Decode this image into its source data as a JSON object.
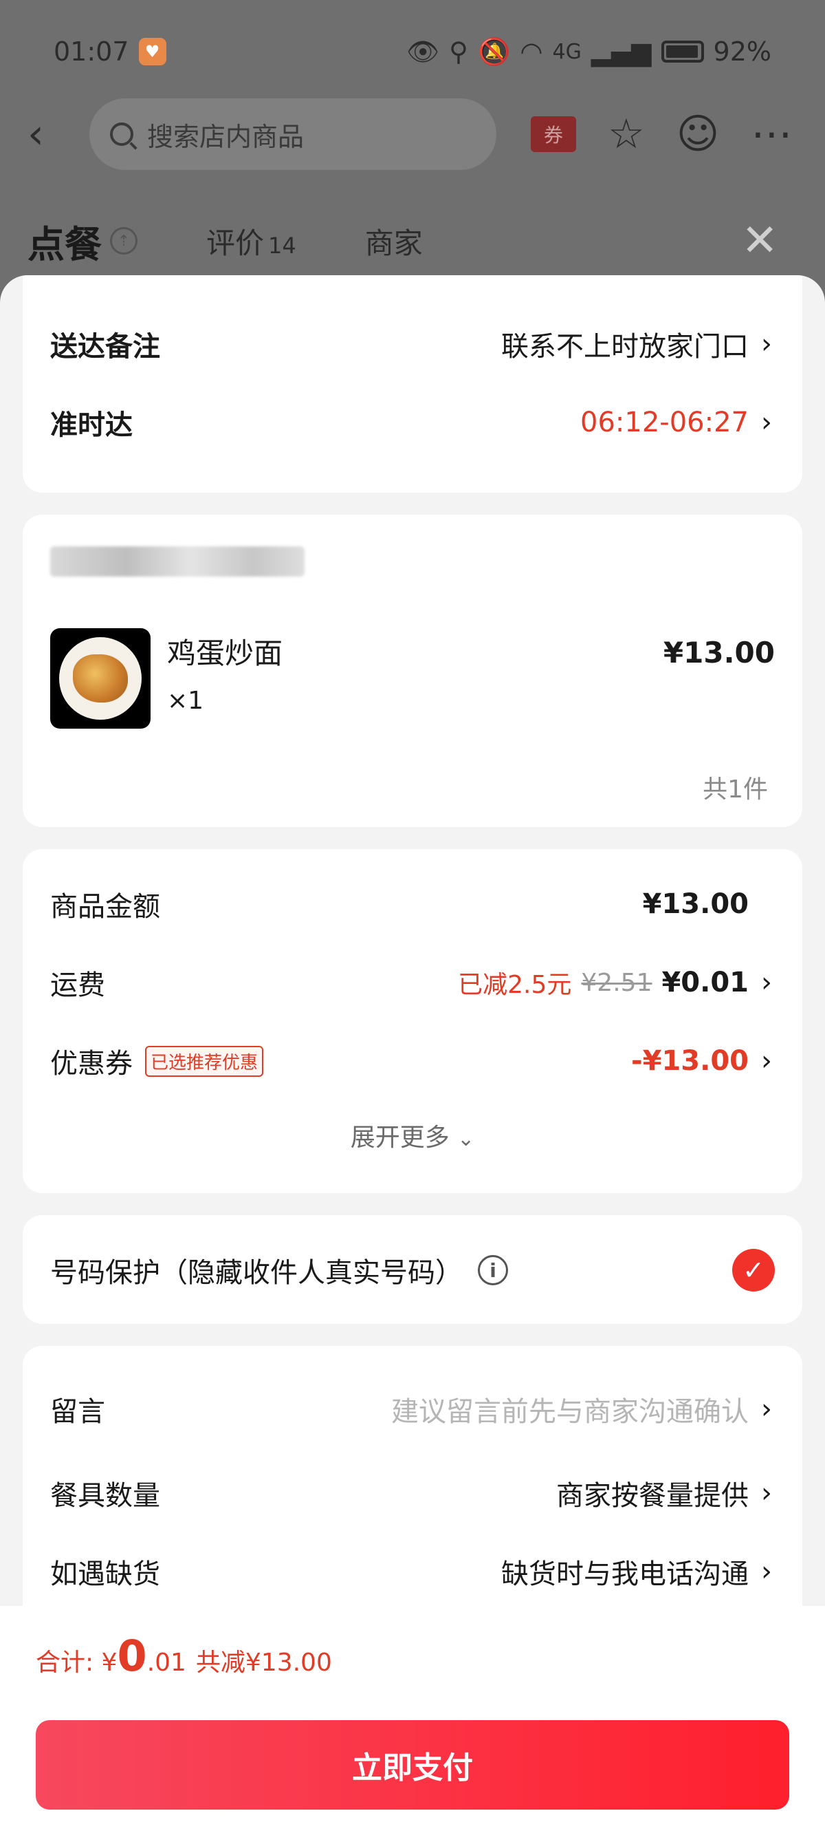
{
  "status_bar": {
    "time": "01:07",
    "signal": "4G",
    "battery": "92%"
  },
  "nav": {
    "search_placeholder": "搜索店内商品",
    "coupon_label": "券"
  },
  "tabs": {
    "order": "点餐",
    "reviews": "评价",
    "reviews_count": "14",
    "merchant": "商家"
  },
  "delivery": {
    "note_label": "送达备注",
    "note_value": "联系不上时放家门口",
    "ontime_label": "准时达",
    "ontime_value": "06:12-06:27"
  },
  "order": {
    "item_name": "鸡蛋炒面",
    "item_qty": "×1",
    "item_price": "¥13.00",
    "total_count": "共1件"
  },
  "pricing": {
    "goods_label": "商品金额",
    "goods_value": "¥13.00",
    "shipping_label": "运费",
    "shipping_discount": "已减2.5元",
    "shipping_original": "¥2.51",
    "shipping_value": "¥0.01",
    "coupon_label": "优惠券",
    "coupon_tag": "已选推荐优惠",
    "coupon_value": "-¥13.00",
    "expand_label": "展开更多"
  },
  "privacy": {
    "label": "号码保护（隐藏收件人真实号码）",
    "checked": true
  },
  "extras": {
    "message_label": "留言",
    "message_placeholder": "建议留言前先与商家沟通确认",
    "tableware_label": "餐具数量",
    "tableware_value": "商家按餐量提供",
    "stockout_label": "如遇缺货",
    "stockout_value": "缺货时与我电话沟通"
  },
  "footer": {
    "total_prefix": "合计: ¥",
    "total_int": "0",
    "total_dec": ".01",
    "saved": "共减¥13.00",
    "pay_button": "立即支付"
  },
  "colors": {
    "accent_red": "#e23b26",
    "pay_button": "#ff1f2d",
    "sheet_bg": "#f3f3f3"
  }
}
